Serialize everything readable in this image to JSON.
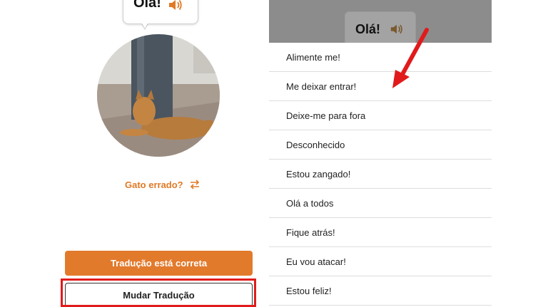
{
  "left": {
    "bubble_text": "Olá!",
    "wrong_cat_label": "Gato errado?",
    "correct_button": "Tradução está correta",
    "change_button": "Mudar Tradução"
  },
  "right": {
    "bubble_text": "Olá!",
    "options": [
      "Alimente me!",
      "Me deixar entrar!",
      "Deixe-me para fora",
      "Desconhecido",
      "Estou zangado!",
      "Olá a todos",
      "Fique atrás!",
      "Eu vou atacar!",
      "Estou feliz!"
    ]
  },
  "colors": {
    "accent": "#e27a2c",
    "highlight": "#e11b1b"
  },
  "icons": [
    "speaker-icon",
    "swap-arrows-icon",
    "red-arrow-annotation"
  ]
}
